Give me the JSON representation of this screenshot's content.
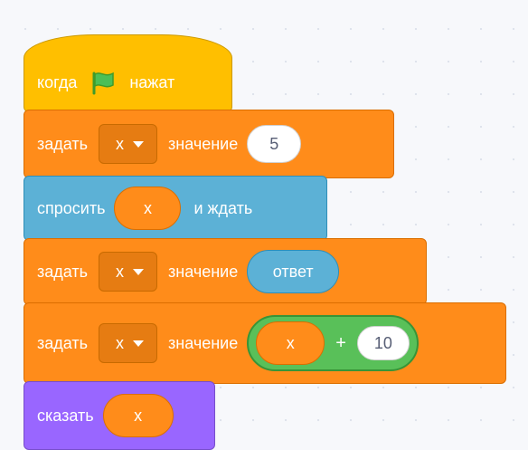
{
  "event_block": {
    "when": "когда",
    "clicked": "нажат",
    "icon": "green-flag-icon"
  },
  "set1": {
    "label": "задать",
    "variable": "x",
    "to": "значение",
    "value": "5"
  },
  "ask": {
    "label": "спросить",
    "variable": "x",
    "wait": "и ждать"
  },
  "set2": {
    "label": "задать",
    "variable": "x",
    "to": "значение",
    "reporter": "ответ"
  },
  "set3": {
    "label": "задать",
    "variable": "x",
    "to": "значение",
    "op_left": "x",
    "op_symbol": "+",
    "op_right": "10"
  },
  "say": {
    "label": "сказать",
    "variable": "x"
  },
  "colors": {
    "events": "#ffbf00",
    "variables": "#ff8c1a",
    "sensing": "#5cb1d6",
    "operators": "#59c059",
    "looks": "#9966ff"
  }
}
